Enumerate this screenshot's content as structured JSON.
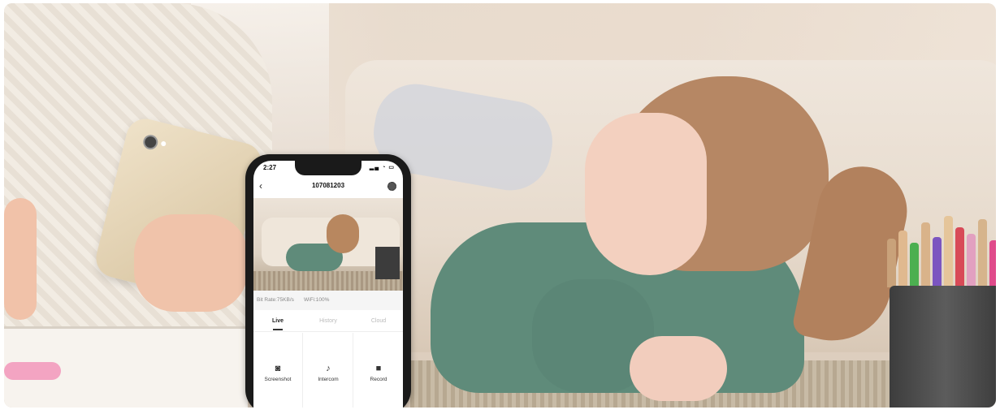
{
  "phone_app": {
    "status_time": "2:27",
    "camera_title": "107081203",
    "bit_rate": "Bit Rate:75KB/s",
    "wifi": "WiFi:100%",
    "tabs": [
      {
        "label": "Live"
      },
      {
        "label": "History"
      },
      {
        "label": "Cloud"
      }
    ],
    "actions": [
      {
        "label": "Screenshot",
        "icon": "camera-icon"
      },
      {
        "label": "Intercom",
        "icon": "microphone-icon"
      },
      {
        "label": "Record",
        "icon": "video-icon"
      }
    ]
  }
}
